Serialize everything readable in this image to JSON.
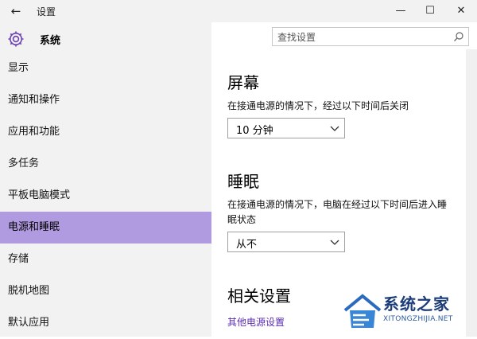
{
  "window": {
    "title": "设置",
    "back_icon": "back-arrow-icon",
    "min_glyph": "—",
    "max_glyph": "☐",
    "close_glyph": "✕"
  },
  "sidebar": {
    "header": "系统",
    "items": [
      {
        "label": "显示"
      },
      {
        "label": "通知和操作"
      },
      {
        "label": "应用和功能"
      },
      {
        "label": "多任务"
      },
      {
        "label": "平板电脑模式"
      },
      {
        "label": "电源和睡眠",
        "active": true
      },
      {
        "label": "存储"
      },
      {
        "label": "脱机地图"
      },
      {
        "label": "默认应用"
      }
    ]
  },
  "search": {
    "placeholder": "查找设置"
  },
  "main": {
    "screen": {
      "title": "屏幕",
      "description": "在接通电源的情况下，经过以下时间后关闭",
      "value": "10 分钟"
    },
    "sleep": {
      "title": "睡眠",
      "description": "在接通电源的情况下，电脑在经过以下时间后进入睡眠状态",
      "value": "从不"
    },
    "related": {
      "title": "相关设置",
      "link": "其他电源设置"
    }
  },
  "watermark": {
    "brand": "系统之家",
    "url": "XITONGZHIJIA.NET"
  },
  "colors": {
    "accent": "#b19be0",
    "link": "#5c2db5",
    "sidebar_bg": "#f2f2f2",
    "gear": "#6a3fb0"
  }
}
